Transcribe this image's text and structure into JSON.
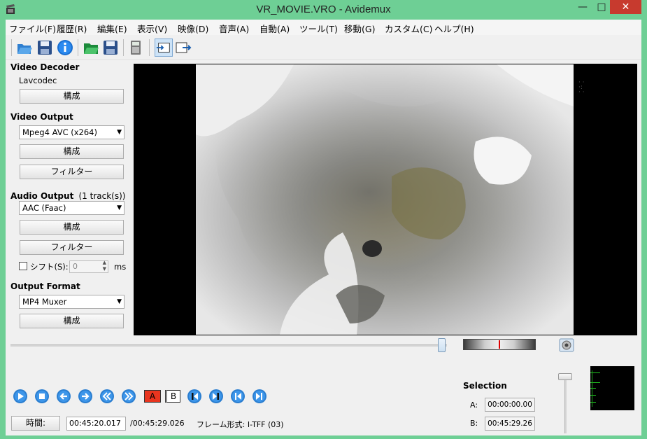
{
  "window": {
    "title": "VR_MOVIE.VRO - Avidemux",
    "minimize_glyph": "—",
    "maximize_glyph": "□",
    "close_glyph": "✕"
  },
  "menu": [
    "ファイル(F)",
    "履歴(R)",
    "編集(E)",
    "表示(V)",
    "映像(D)",
    "音声(A)",
    "自動(A)",
    "ツール(T)",
    "移動(G)",
    "カスタム(C)",
    "ヘルプ(H)"
  ],
  "toolbar": {
    "icons": [
      "open-folder-icon",
      "save-icon",
      "info-icon",
      "open-project-icon",
      "save-project-icon",
      "calculator-icon",
      "input-view-icon",
      "output-view-icon"
    ]
  },
  "video_decoder": {
    "title": "Video Decoder",
    "codec": "Lavcodec",
    "configure_label": "構成"
  },
  "video_output": {
    "title": "Video Output",
    "codec": "Mpeg4 AVC (x264)",
    "configure_label": "構成",
    "filters_label": "フィルター"
  },
  "audio_output": {
    "title": "Audio Output",
    "tracks": "(1 track(s))",
    "codec": "AAC (Faac)",
    "configure_label": "構成",
    "filters_label": "フィルター",
    "shift_label": "シフト(S):",
    "shift_value": "0",
    "shift_unit": "ms",
    "shift_checked": false
  },
  "output_format": {
    "title": "Output Format",
    "muxer": "MP4 Muxer",
    "configure_label": "構成"
  },
  "transport": {
    "buttons": [
      "play-icon",
      "stop-icon",
      "previous-frame-icon",
      "next-frame-icon",
      "rewind-icon",
      "fast-forward-icon"
    ],
    "marker_a": "A",
    "marker_b": "B",
    "nav_buttons": [
      "go-marker-a-icon",
      "go-marker-b-icon",
      "previous-keyframe-icon",
      "next-keyframe-icon"
    ]
  },
  "seek_position": 0.996,
  "time": {
    "button_label": "時間:",
    "current": "00:45:20.017",
    "total": "/00:45:29.026",
    "frame_type": "フレーム形式: I-TFF (03)"
  },
  "selection": {
    "title": "Selection",
    "a_label": "A:",
    "a_value": "00:00:00.00",
    "b_label": "B:",
    "b_value": "00:45:29.26"
  },
  "colors": {
    "window_frame": "#6ecf95",
    "close_button": "#c73a2e",
    "marker_a": "#e8351f",
    "meter": "#22c622"
  }
}
